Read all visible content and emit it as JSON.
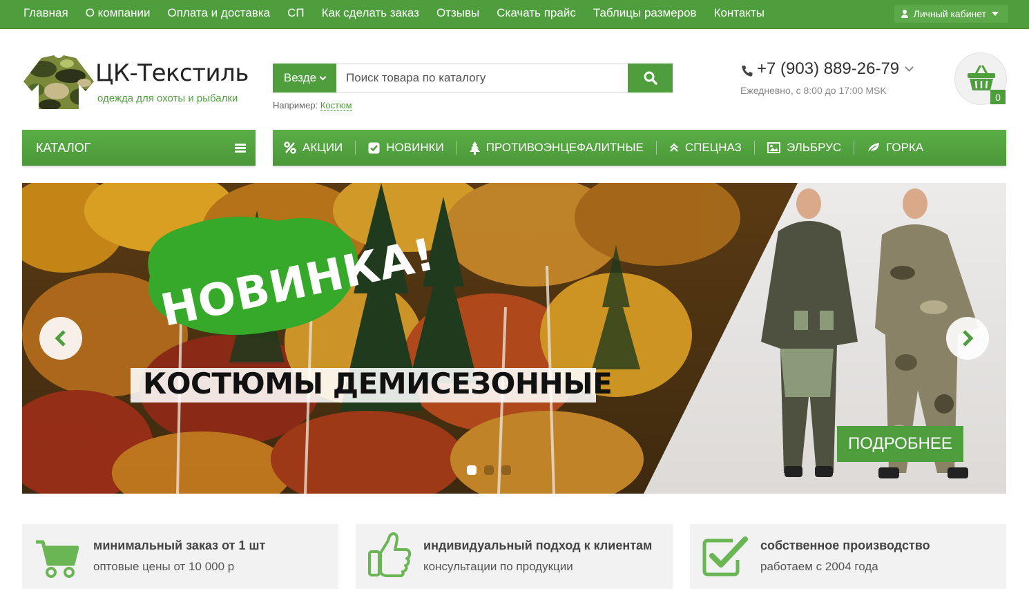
{
  "topnav": {
    "items": [
      "Главная",
      "О компании",
      "Оплата и доставка",
      "СП",
      "Как сделать заказ",
      "Отзывы",
      "Скачать прайс",
      "Таблицы размеров",
      "Контакты"
    ],
    "cabinet_label": "Личный кабинет"
  },
  "header": {
    "logo_title": "ЦК-Текстиль",
    "logo_subtitle": "одежда для охоты и рыбалки",
    "search_scope": "Везде",
    "search_placeholder": "Поиск товара по каталогу",
    "example_label": "Например:",
    "example_link": "Костюм",
    "phone": "+7 (903) 889-26-79",
    "hours": "Ежедневно, с 8:00 до 17:00 MSK",
    "cart_count": "0"
  },
  "catalog_label": "КАТАЛОГ",
  "category_nav": [
    {
      "label": "АКЦИИ",
      "icon": "percent-icon"
    },
    {
      "label": "НОВИНКИ",
      "icon": "checkbox-icon"
    },
    {
      "label": "ПРОТИВОЭНЦЕФАЛИТНЫЕ",
      "icon": "tree-icon"
    },
    {
      "label": "СПЕЦНАЗ",
      "icon": "double-chevron-up-icon"
    },
    {
      "label": "ЭЛЬБРУС",
      "icon": "image-icon"
    },
    {
      "label": "ГОРКА",
      "icon": "leaf-icon"
    }
  ],
  "banner": {
    "badge": "НОВИНКА!",
    "headline": "КОСТЮМЫ ДЕМИСЕЗОННЫЕ",
    "button": "ПОДРОБНЕЕ",
    "slides_total": 3,
    "active_slide": 1
  },
  "features": [
    {
      "title": "минимальный заказ от 1 шт",
      "subtitle": "оптовые цены от 10 000 р",
      "icon": "cart-icon"
    },
    {
      "title": "индивидуальный подход к клиентам",
      "subtitle": "консультации по продукции",
      "icon": "thumbs-up-icon"
    },
    {
      "title": "собственное производство",
      "subtitle": "работаем с 2004 года",
      "icon": "check-square-icon"
    }
  ],
  "colors": {
    "brand_green": "#4f9e3d",
    "text_dark": "#333333",
    "feature_bg": "#f2f2f2"
  }
}
